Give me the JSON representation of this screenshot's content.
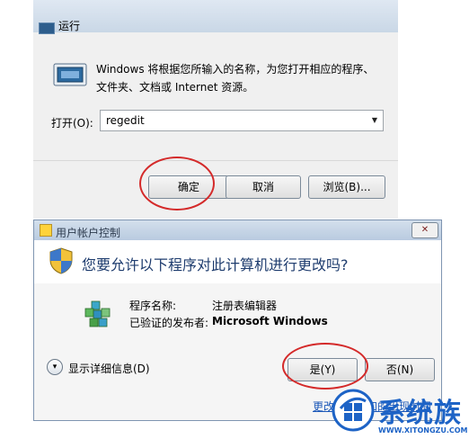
{
  "run_dialog": {
    "title": "运行",
    "description": "Windows 将根据您所输入的名称，为您打开相应的程序、文件夹、文档或 Internet 资源。",
    "open_label": "打开(O):",
    "open_value": "regedit",
    "buttons": {
      "ok": "确定",
      "cancel": "取消",
      "browse": "浏览(B)..."
    }
  },
  "uac_dialog": {
    "title": "用户帐户控制",
    "question": "您要允许以下程序对此计算机进行更改吗?",
    "program_name_label": "程序名称:",
    "program_name": "注册表编辑器",
    "publisher_label": "已验证的发布者:",
    "publisher": "Microsoft Windows",
    "details_label": "显示详细信息(D)",
    "buttons": {
      "yes": "是(Y)",
      "no": "否(N)"
    },
    "link_text": "更改这些通知的出现时间",
    "close_glyph": "✕"
  },
  "watermark": {
    "brand": "系统族",
    "url": "WWW.XITONGZU.COM"
  },
  "colors": {
    "annotation_red": "#d42a2a",
    "uac_heading": "#1e3c6e",
    "watermark_blue": "#1d63c6"
  }
}
